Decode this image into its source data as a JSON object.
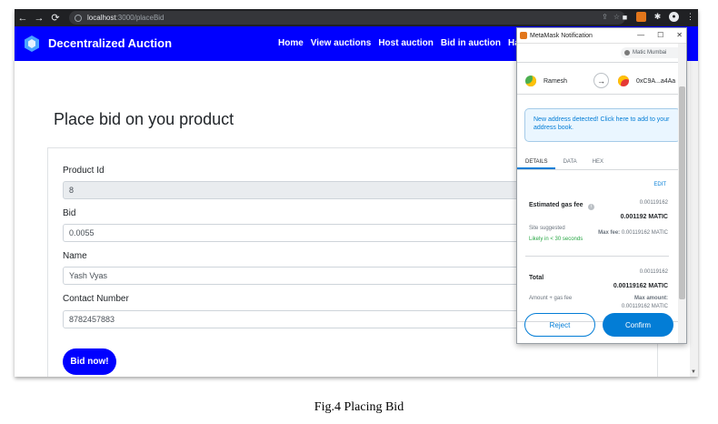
{
  "browser": {
    "back_icon": "←",
    "forward_icon": "→",
    "reload_icon": "⟳",
    "url_host": "localhost",
    "url_path": ":3000/placeBid"
  },
  "app": {
    "brand": "Decentralized Auction",
    "nav": [
      "Home",
      "View auctions",
      "Host auction",
      "Bid in auction",
      "Ha"
    ]
  },
  "page": {
    "title": "Place bid on you product",
    "fields": {
      "product_id_label": "Product Id",
      "product_id_value": "8",
      "bid_label": "Bid",
      "bid_value": "0.0055",
      "name_label": "Name",
      "name_value": "Yash Vyas",
      "contact_label": "Contact Number",
      "contact_value": "8782457883"
    },
    "bid_button": "Bid now!"
  },
  "metamask": {
    "window_title": "MetaMask Notification",
    "network": "Matic Mumbai",
    "from_account": "Ramesh",
    "to_account": "0xC9A...a4Aa",
    "notice": "New address detected! Click here to add to your address book.",
    "tabs": [
      "DETAILS",
      "DATA",
      "HEX"
    ],
    "edit": "EDIT",
    "gas_fee_label": "Estimated gas fee",
    "gas_fee_small": "0.00119162",
    "gas_fee_bold": "0.001192 MATIC",
    "site_suggested": "Site suggested",
    "likely": "Likely in < 30 seconds",
    "max_fee_label": "Max fee:",
    "max_fee_value": "0.00119162 MATIC",
    "total_label": "Total",
    "total_small": "0.00119162",
    "total_bold": "0.00119162 MATIC",
    "amount_gas_label": "Amount + gas fee",
    "max_amount_label": "Max amount:",
    "max_amount_value": "0.00119162 MATIC",
    "reject": "Reject",
    "confirm": "Confirm"
  },
  "caption": "Fig.4 Placing Bid",
  "colors": {
    "brand_blue": "#0000ff",
    "metamask_blue": "#037dd6",
    "chrome_dark": "#202124"
  }
}
